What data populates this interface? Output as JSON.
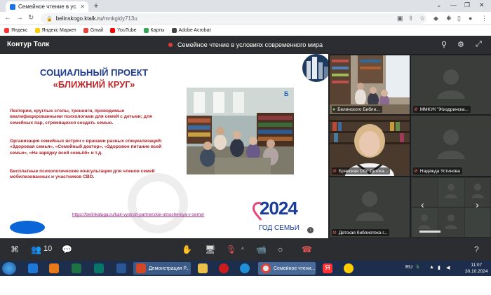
{
  "browser": {
    "tab_title": "Семейное чтение в условия",
    "url_host": "belinskogo.ktalk.ru",
    "url_path": "/mnkgidy713u",
    "bookmarks": [
      {
        "label": "Яндекс",
        "color": "#ff3333"
      },
      {
        "label": "Яндекс Маркет",
        "color": "#ffcc00"
      },
      {
        "label": "Gmail",
        "color": "#ea4335"
      },
      {
        "label": "YouTube",
        "color": "#ff0000"
      },
      {
        "label": "Карты",
        "color": "#34a853"
      },
      {
        "label": "Adobe Acrobat",
        "color": "#444444"
      }
    ]
  },
  "app": {
    "title": "Контур Толк",
    "meeting_title": "Семейное чтение в условиях современного мира"
  },
  "slide": {
    "title_line1": "СОЦИАЛЬНЫЙ ПРОЕКТ",
    "title_line2": "«БЛИЖНИЙ КРУГ»",
    "paragraphs": [
      "Лектории, круглые столы, тренниги, проводимые квалифицированными психологами для семей с детьми; для семейных пар, стремящихся создать семью.",
      "Организация семейных встреч с врачами разных специализаций: «Здоровая семья», «Семейный доктор», «Здоровое питание всей семьи», «На зарядку всей семьёй» и т.д.",
      "Бесплатные психологические консультации для членов семей мобилизованных и участников СВО."
    ],
    "link": "https://belinkaluga.ru/kak-vystroit-partnerskie-otnosheniya-v-seme/",
    "year_number": "2024",
    "year_caption": "ГОД СЕМЬИ"
  },
  "participants": [
    {
      "name": "Белинского Библи...",
      "muted": false
    },
    {
      "name": "ММКУК \"Жиздринска...",
      "muted": true
    },
    {
      "name": "Брянская Обл Детска...",
      "muted": true
    },
    {
      "name": "Надежда Устинова",
      "muted": true
    },
    {
      "name": "Детская библиотека г...",
      "muted": true
    }
  ],
  "controls": {
    "participant_count": "10",
    "help": "?"
  },
  "taskbar": {
    "items": [
      {
        "label": "Демонстрация Р...",
        "color": "#d24726"
      },
      {
        "label": "Семейное чтени...",
        "color": "#e8e8e8"
      }
    ],
    "lang": "RU",
    "time": "11:07",
    "date": "30.10.2024"
  }
}
